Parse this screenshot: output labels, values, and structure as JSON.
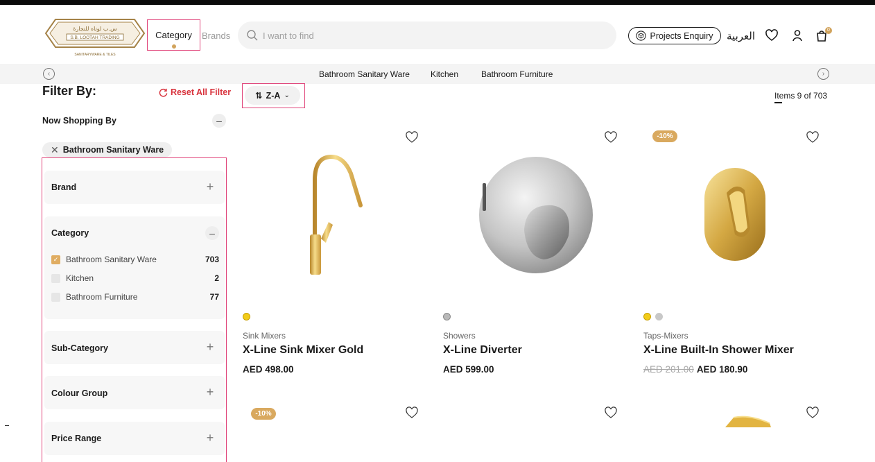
{
  "header": {
    "logo_text_ar": "س.ب لوتاه للتجارة",
    "logo_text_en": "S.B. LOOTAH TRADING",
    "logo_tagline": "SANITARYWARE & TILES",
    "category_label": "Category",
    "brands_label": "Brands",
    "search_placeholder": "I want to find",
    "projects_enquiry": "Projects Enquiry",
    "language": "العربية",
    "cart_count": "0"
  },
  "catnav": {
    "items": [
      "Bathroom Sanitary Ware",
      "Kitchen",
      "Bathroom Furniture"
    ]
  },
  "sidebar": {
    "filter_title": "Filter By:",
    "reset_label": "Reset All Filter",
    "now_shopping_label": "Now Shopping By",
    "active_chip": "Bathroom Sanitary Ware",
    "sections": {
      "brand": "Brand",
      "category": "Category",
      "sub_category": "Sub-Category",
      "colour_group": "Colour Group",
      "price_range": "Price Range"
    },
    "category_options": [
      {
        "label": "Bathroom Sanitary Ware",
        "count": "703",
        "checked": true
      },
      {
        "label": "Kitchen",
        "count": "2",
        "checked": false
      },
      {
        "label": "Bathroom Furniture",
        "count": "77",
        "checked": false
      }
    ]
  },
  "listing": {
    "sort_label": "Z-A",
    "items_count": "Items 9 of 703"
  },
  "products": [
    {
      "category": "Sink Mixers",
      "name": "X-Line Sink Mixer Gold",
      "price": "AED 498.00",
      "old_price": "",
      "badge": ""
    },
    {
      "category": "Showers",
      "name": "X-Line Diverter",
      "price": "AED 599.00",
      "old_price": "",
      "badge": ""
    },
    {
      "category": "Taps-Mixers",
      "name": "X-Line Built-In Shower Mixer",
      "price": "AED 180.90",
      "old_price": "AED 201.00",
      "badge": "-10%"
    }
  ],
  "next_row": {
    "badge": "-10%"
  },
  "colors": {
    "accent_gold": "#d9a95f",
    "highlight_pink": "#e0447a",
    "reset_red": "#d8323c"
  }
}
